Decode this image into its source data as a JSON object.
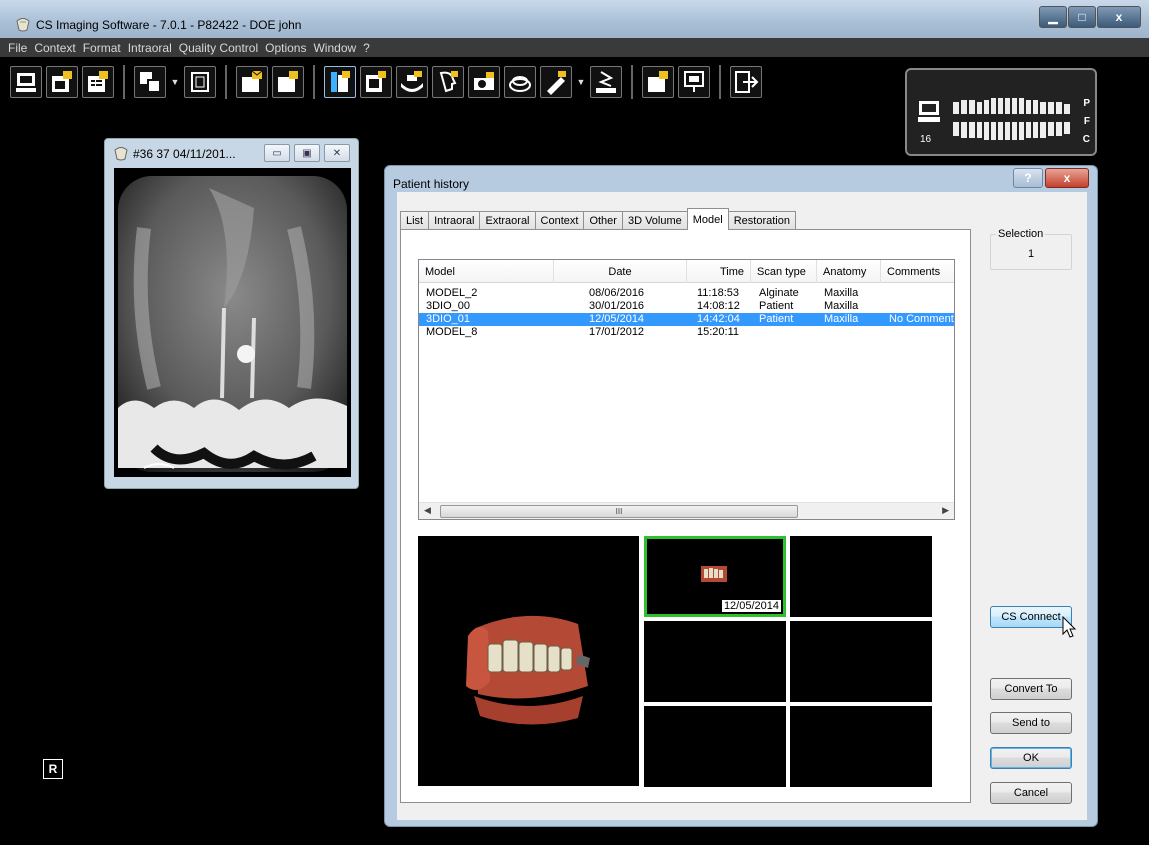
{
  "app": {
    "title": "CS Imaging Software - 7.0.1 - P82422  - DOE john",
    "menu": [
      "File",
      "Context",
      "Format",
      "Intraoral",
      "Quality Control",
      "Options",
      "Window",
      "?"
    ]
  },
  "odontogram": {
    "count": "16",
    "labels": [
      "P",
      "F",
      "C"
    ]
  },
  "xray_window": {
    "title": "#36 37 04/11/201..."
  },
  "side_badge": "R",
  "dialog": {
    "title": "Patient history",
    "tabs": [
      "List",
      "Intraoral",
      "Extraoral",
      "Context",
      "Other",
      "3D Volume",
      "Model",
      "Restoration"
    ],
    "active_tab": "Model",
    "columns": [
      "Model",
      "Date",
      "Time",
      "Scan type",
      "Anatomy",
      "Comments"
    ],
    "rows": [
      {
        "model": "MODEL_2",
        "date": "08/06/2016",
        "time": "11:18:53",
        "scan_type": "Alginate",
        "anatomy": "Maxilla",
        "comments": ""
      },
      {
        "model": "3DIO_00",
        "date": "30/01/2016",
        "time": "14:08:12",
        "scan_type": "Patient",
        "anatomy": "Maxilla",
        "comments": ""
      },
      {
        "model": "3DIO_01",
        "date": "12/05/2014",
        "time": "14:42:04",
        "scan_type": "Patient",
        "anatomy": "Maxilla",
        "comments": "No Comment"
      },
      {
        "model": "MODEL_8",
        "date": "17/01/2012",
        "time": "15:20:11",
        "scan_type": "",
        "anatomy": "",
        "comments": ""
      }
    ],
    "selected_row": 2,
    "scroll_thumb": "III",
    "thumbnail_date": "12/05/2014",
    "selection": {
      "label": "Selection",
      "value": "1"
    },
    "buttons": {
      "cs_connect": "CS Connect",
      "convert_to": "Convert To",
      "send_to": "Send to",
      "ok": "OK",
      "cancel": "Cancel"
    }
  },
  "colors": {
    "selection": "#3399ff",
    "thumb_border": "#2fc02f"
  }
}
